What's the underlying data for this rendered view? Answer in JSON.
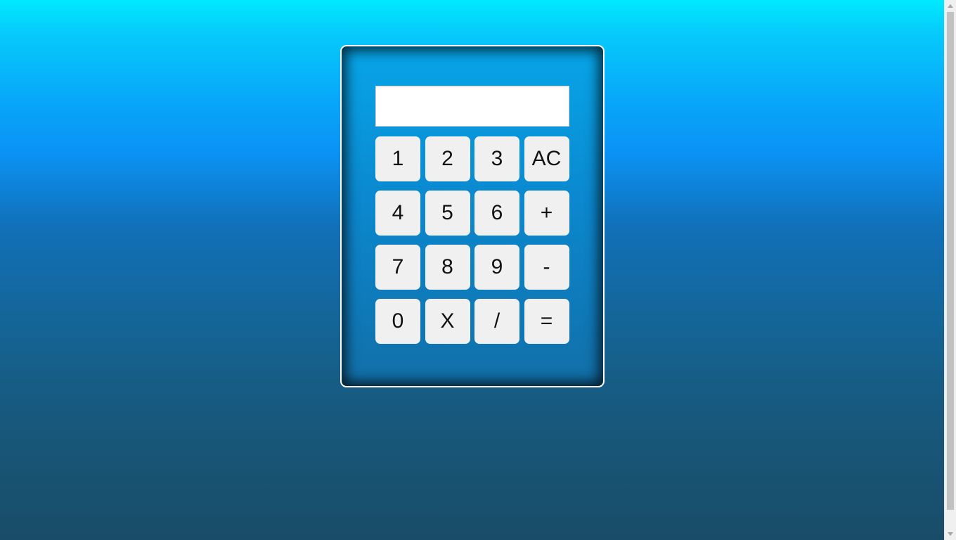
{
  "display": {
    "value": ""
  },
  "keypad": {
    "keys": [
      {
        "label": "1",
        "name": "key-1-button"
      },
      {
        "label": "2",
        "name": "key-2-button"
      },
      {
        "label": "3",
        "name": "key-3-button"
      },
      {
        "label": "AC",
        "name": "all-clear-button"
      },
      {
        "label": "4",
        "name": "key-4-button"
      },
      {
        "label": "5",
        "name": "key-5-button"
      },
      {
        "label": "6",
        "name": "key-6-button"
      },
      {
        "label": "+",
        "name": "add-button"
      },
      {
        "label": "7",
        "name": "key-7-button"
      },
      {
        "label": "8",
        "name": "key-8-button"
      },
      {
        "label": "9",
        "name": "key-9-button"
      },
      {
        "label": "-",
        "name": "subtract-button"
      },
      {
        "label": "0",
        "name": "key-0-button"
      },
      {
        "label": "X",
        "name": "multiply-button"
      },
      {
        "label": "/",
        "name": "divide-button"
      },
      {
        "label": "=",
        "name": "equals-button"
      }
    ]
  },
  "colors": {
    "background_top": "#00eaff",
    "background_bottom": "#194c67",
    "key_background": "#f0f0f0",
    "calculator_border": "#ffffff"
  }
}
